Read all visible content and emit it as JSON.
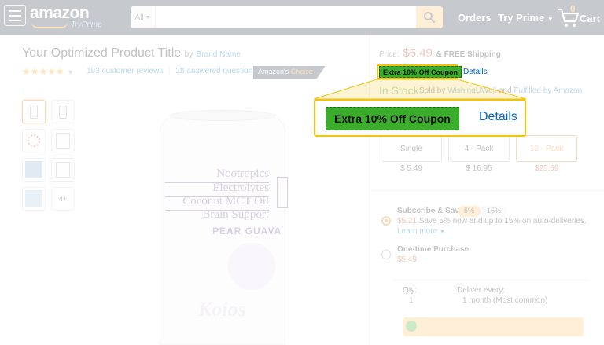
{
  "header": {
    "logo_text": "amazon",
    "tryprime_badge": "TryPrime",
    "search": {
      "department": "All",
      "placeholder": ""
    },
    "orders": "Orders",
    "try_prime": "Try Prime",
    "cart_count": "0",
    "cart_label": "Cart"
  },
  "product": {
    "title": "Your Optimized Product Title",
    "by": "by",
    "brand": "Brand Name",
    "rating_stars": "★★★★★",
    "reviews": "193 customer reviews",
    "separator": "|",
    "answered": "28 answered questions",
    "badge_prefix": "Amazon's",
    "badge_choice": "Choice",
    "thumbnail_more": "4+"
  },
  "can": {
    "lines": [
      "Nootropics",
      "Electrolytes",
      "Coconut MCT Oil",
      "Brain Support"
    ],
    "flavor": "PEAR GUAVA",
    "script_logo": "Koios"
  },
  "buybox": {
    "price_label": "Price:",
    "price": "$5.49",
    "shipping": "& FREE Shipping",
    "coupon": "Extra 10% Off Coupon",
    "details": "Details",
    "in_stock": "In Stock.",
    "sold_prefix": "Sold by",
    "seller": "WishingUWell",
    "fulfilled_mid": "and",
    "fulfilled": "Fulfilled by Amazon.",
    "options": [
      {
        "label": "Single",
        "price": "$ 5.49"
      },
      {
        "label": "4 - Pack",
        "price": "$ 16.95"
      },
      {
        "label": "12 - Pack",
        "price": "$25.69"
      }
    ],
    "subscribe": {
      "label": "Subscribe & Save",
      "pill_a": "5%",
      "pill_b": "15%",
      "price": "$5.21",
      "desc": "Save 5% now and up to 15% on auto-deliveries.",
      "learn_more": "Learn more"
    },
    "one_time": {
      "label": "One-time Purchase",
      "price": "$5.49"
    },
    "qty_label": "Qty:",
    "qty_value": "1",
    "deliver_label": "Deliver every:",
    "deliver_value": "1 month (Most common)"
  },
  "callout": {
    "coupon": "Extra 10% Off Coupon",
    "details": "Details"
  },
  "colors": {
    "header_bg": "#232f3e",
    "coupon_green": "#3bac2b",
    "highlight_yellow": "#f1c40f",
    "link_blue": "#0066c0",
    "price_red": "#b12704",
    "accent_orange": "#e77600"
  }
}
